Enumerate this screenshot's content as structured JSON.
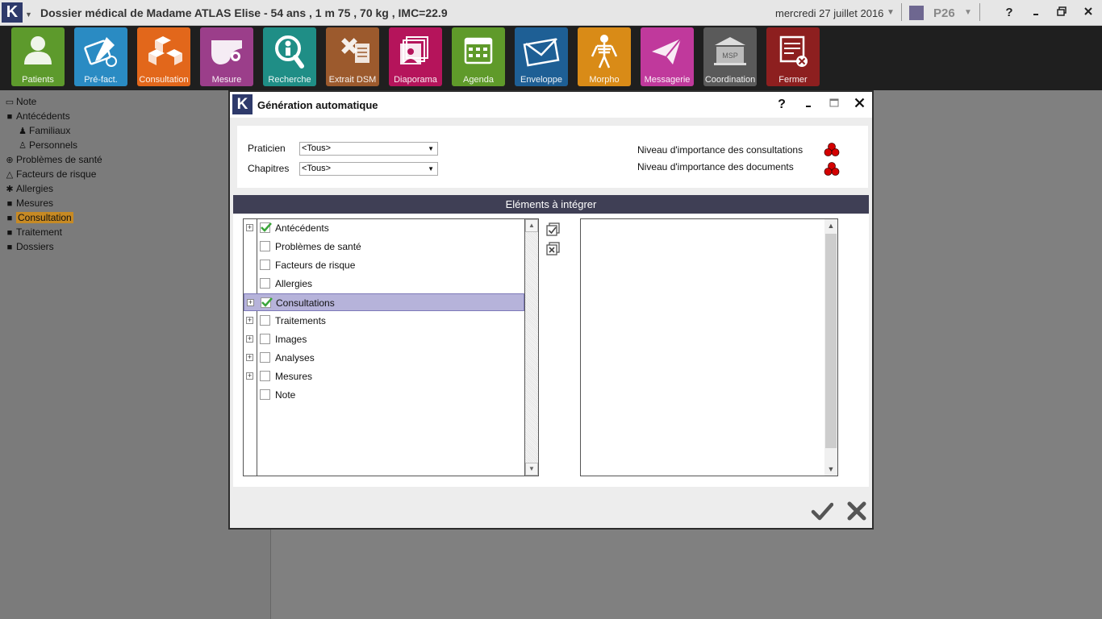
{
  "window": {
    "title": "Dossier médical de Madame ATLAS Elise - 54 ans ,  1 m 75 ,  70 kg ,  IMC=22.9",
    "logo": "K",
    "date": "mercredi 27 juillet 2016",
    "post_code": "P26",
    "swatch_color": "#6e6790",
    "help": "?"
  },
  "toolbar": {
    "buttons": [
      {
        "label": "Patients",
        "color": "#5d9a2c",
        "icon": "person-icon"
      },
      {
        "label": "Pré-fact.",
        "color": "#2a8bc3",
        "icon": "pen-tablet-icon"
      },
      {
        "label": "Consultation",
        "color": "#e2671b",
        "icon": "boxes-icon"
      },
      {
        "label": "Mesure",
        "color": "#9b3e8a",
        "icon": "palette-icon"
      },
      {
        "label": "Recherche",
        "color": "#1f8e86",
        "icon": "search-person-icon"
      },
      {
        "label": "Extrait DSM",
        "color": "#9c5a2d",
        "icon": "medical-doc-icon"
      },
      {
        "label": "Diaporama",
        "color": "#b5145b",
        "icon": "slideshow-icon"
      },
      {
        "label": "Agenda",
        "color": "#5f9a2a",
        "icon": "calendar-icon"
      },
      {
        "label": "Enveloppe",
        "color": "#1e5f95",
        "icon": "envelope-icon"
      },
      {
        "label": "Morpho",
        "color": "#d98b17",
        "icon": "skeleton-icon"
      },
      {
        "label": "Messagerie",
        "color": "#c0399c",
        "icon": "paper-plane-icon"
      },
      {
        "label": "Coordination",
        "color": "#5a5a5a",
        "icon": "msp-building-icon"
      },
      {
        "label": "Fermer",
        "color": "#8d1f1f",
        "icon": "close-window-icon"
      }
    ],
    "msp_text": "MSP"
  },
  "left_tree": {
    "items": [
      {
        "label": "Note",
        "icon": "note-icon"
      },
      {
        "label": "Antécédents",
        "icon": "folder-icon"
      },
      {
        "label": "Familiaux",
        "icon": "family-icon"
      },
      {
        "label": "Personnels",
        "icon": "person-icon"
      },
      {
        "label": "Problèmes de santé",
        "icon": "health-icon"
      },
      {
        "label": "Facteurs de risque",
        "icon": "warning-icon"
      },
      {
        "label": "Allergies",
        "icon": "bug-icon"
      },
      {
        "label": "Mesures",
        "icon": "folder-icon"
      },
      {
        "label": "Consultation",
        "icon": "folder-icon",
        "selected": true
      },
      {
        "label": "Traitement",
        "icon": "folder-icon"
      },
      {
        "label": "Dossiers",
        "icon": "folder-icon"
      }
    ]
  },
  "dialog": {
    "logo": "K",
    "title": "Génération automatique",
    "help": "?",
    "filters": {
      "praticien_label": "Praticien",
      "praticien_value": "<Tous>",
      "chapitres_label": "Chapitres",
      "chapitres_value": "<Tous>",
      "level_consultations": "Niveau d'importance des consultations",
      "level_documents": "Niveau d'importance des documents"
    },
    "section_title": "Eléments à intégrer",
    "items": [
      {
        "label": "Antécédents",
        "checked": true,
        "expandable": true,
        "selected": false
      },
      {
        "label": "Problèmes de santé",
        "checked": false,
        "expandable": false,
        "selected": false
      },
      {
        "label": "Facteurs de risque",
        "checked": false,
        "expandable": false,
        "selected": false
      },
      {
        "label": "Allergies",
        "checked": false,
        "expandable": false,
        "selected": false
      },
      {
        "label": "Consultations",
        "checked": true,
        "expandable": true,
        "selected": true
      },
      {
        "label": "Traitements",
        "checked": false,
        "expandable": true,
        "selected": false
      },
      {
        "label": "Images",
        "checked": false,
        "expandable": true,
        "selected": false
      },
      {
        "label": "Analyses",
        "checked": false,
        "expandable": true,
        "selected": false
      },
      {
        "label": "Mesures",
        "checked": false,
        "expandable": true,
        "selected": false
      },
      {
        "label": "Note",
        "checked": false,
        "expandable": false,
        "selected": false
      }
    ],
    "check_color": "#3aa53a",
    "selection_color": "#b6b3da"
  }
}
